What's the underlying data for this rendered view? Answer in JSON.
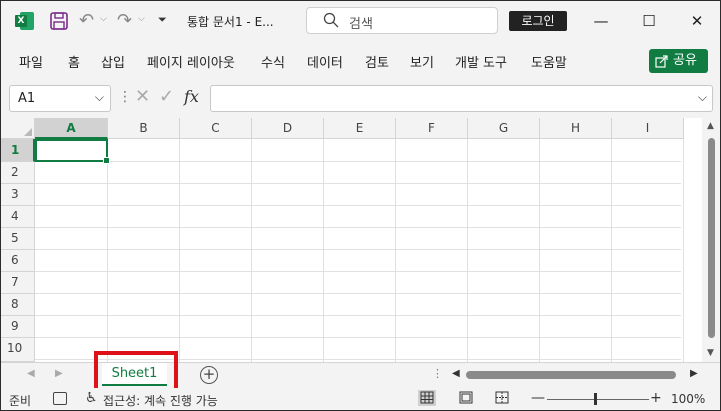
{
  "titlebar": {
    "app_icon_letter": "X",
    "undo_drop": "⌵",
    "redo_drop": "⌵",
    "qat_more": "⏷",
    "doc_title": "통합 문서1  -  E...",
    "search_placeholder": "검색",
    "login_label": "로그인",
    "minimize": "—",
    "maximize": "☐",
    "close": "✕"
  },
  "ribbon": {
    "tabs": [
      "파일",
      "홈",
      "삽입",
      "페이지 레이아웃",
      "수식",
      "데이터",
      "검토",
      "보기",
      "개발 도구",
      "도움말"
    ],
    "share_label": "공유"
  },
  "formula_bar": {
    "name_box": "A1",
    "name_drop": "⌵",
    "separator": "⋮",
    "cancel": "✕",
    "enter": "✓",
    "fx": "fx",
    "formula": "",
    "expand": "⌵"
  },
  "grid": {
    "columns": [
      "A",
      "B",
      "C",
      "D",
      "E",
      "F",
      "G",
      "H",
      "I"
    ],
    "rows": [
      "1",
      "2",
      "3",
      "4",
      "5",
      "6",
      "7",
      "8",
      "9",
      "10"
    ],
    "active_column": "A",
    "active_row": "1"
  },
  "sheet_tabs": {
    "prev": "◀",
    "next": "▶",
    "sheets": [
      "Sheet1"
    ],
    "add": "+",
    "split": "⋮",
    "scroll_left": "◀",
    "scroll_right": "▶"
  },
  "statusbar": {
    "ready": "준비",
    "accessibility": "접근성: 계속 진행 가능",
    "zoom_minus": "—",
    "zoom_plus": "+",
    "zoom": "100%"
  },
  "colors": {
    "accent": "#107c41",
    "highlight_box": "#e0101b"
  }
}
